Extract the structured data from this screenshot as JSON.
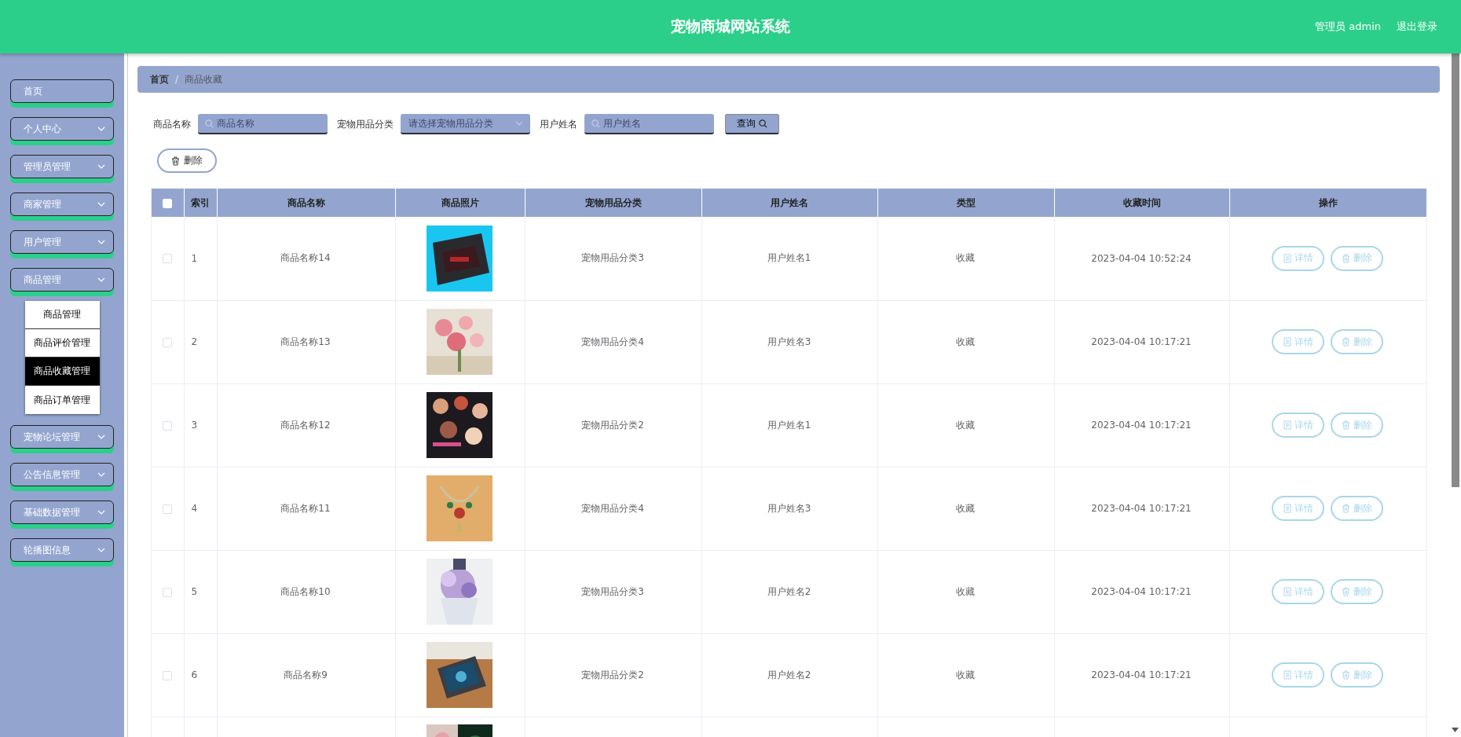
{
  "header": {
    "title": "宠物商城网站系统",
    "user": "管理员 admin",
    "logout": "退出登录"
  },
  "sidebar": {
    "items": [
      {
        "label": "首页",
        "kind": "link"
      },
      {
        "label": "个人中心",
        "kind": "group"
      },
      {
        "label": "管理员管理",
        "kind": "group"
      },
      {
        "label": "商家管理",
        "kind": "group"
      },
      {
        "label": "用户管理",
        "kind": "group"
      },
      {
        "label": "商品管理",
        "kind": "group",
        "expanded": true,
        "children": [
          {
            "label": "商品管理",
            "selected": false
          },
          {
            "label": "商品评价管理",
            "selected": false
          },
          {
            "label": "商品收藏管理",
            "selected": true
          },
          {
            "label": "商品订单管理",
            "selected": false
          }
        ]
      },
      {
        "label": "宠物论坛管理",
        "kind": "group"
      },
      {
        "label": "公告信息管理",
        "kind": "group"
      },
      {
        "label": "基础数据管理",
        "kind": "group"
      },
      {
        "label": "轮播图信息",
        "kind": "group"
      }
    ]
  },
  "breadcrumb": {
    "items": [
      "首页",
      "商品收藏"
    ],
    "separator": "/"
  },
  "filters": [
    {
      "label": "商品名称",
      "kind": "search",
      "placeholder": "商品名称"
    },
    {
      "label": "宠物用品分类",
      "kind": "select",
      "placeholder": "请选择宠物用品分类"
    },
    {
      "label": "用户姓名",
      "kind": "search",
      "placeholder": "用户姓名"
    }
  ],
  "query_button": "查询",
  "delete_button": "删除",
  "table": {
    "select_all_checked": false,
    "columns": [
      "索引",
      "商品名称",
      "商品照片",
      "宠物用品分类",
      "用户姓名",
      "类型",
      "收藏时间",
      "操作"
    ],
    "rows": [
      {
        "checked": false,
        "index": "1",
        "name": "商品名称14",
        "photo": {
          "kind": "picture"
        },
        "category": "宠物用品分类3",
        "user": "用户姓名1",
        "type": "收藏",
        "time": "2023-04-04 10:52:24",
        "actions": [
          "详情",
          "删除"
        ]
      },
      {
        "checked": false,
        "index": "2",
        "name": "商品名称13",
        "photo": {
          "kind": "picture"
        },
        "category": "宠物用品分类4",
        "user": "用户姓名3",
        "type": "收藏",
        "time": "2023-04-04 10:17:21",
        "actions": [
          "详情",
          "删除"
        ]
      },
      {
        "checked": false,
        "index": "3",
        "name": "商品名称12",
        "photo": {
          "kind": "picture"
        },
        "category": "宠物用品分类2",
        "user": "用户姓名1",
        "type": "收藏",
        "time": "2023-04-04 10:17:21",
        "actions": [
          "详情",
          "删除"
        ]
      },
      {
        "checked": false,
        "index": "4",
        "name": "商品名称11",
        "photo": {
          "kind": "picture"
        },
        "category": "宠物用品分类4",
        "user": "用户姓名3",
        "type": "收藏",
        "time": "2023-04-04 10:17:21",
        "actions": [
          "详情",
          "删除"
        ]
      },
      {
        "checked": false,
        "index": "5",
        "name": "商品名称10",
        "photo": {
          "kind": "picture"
        },
        "category": "宠物用品分类3",
        "user": "用户姓名2",
        "type": "收藏",
        "time": "2023-04-04 10:17:21",
        "actions": [
          "详情",
          "删除"
        ]
      },
      {
        "checked": false,
        "index": "6",
        "name": "商品名称9",
        "photo": {
          "kind": "picture"
        },
        "category": "宠物用品分类2",
        "user": "用户姓名2",
        "type": "收藏",
        "time": "2023-04-04 10:17:21",
        "actions": [
          "详情",
          "删除"
        ]
      }
    ],
    "cut_row": {
      "photo": {
        "kind": "picture"
      }
    }
  }
}
